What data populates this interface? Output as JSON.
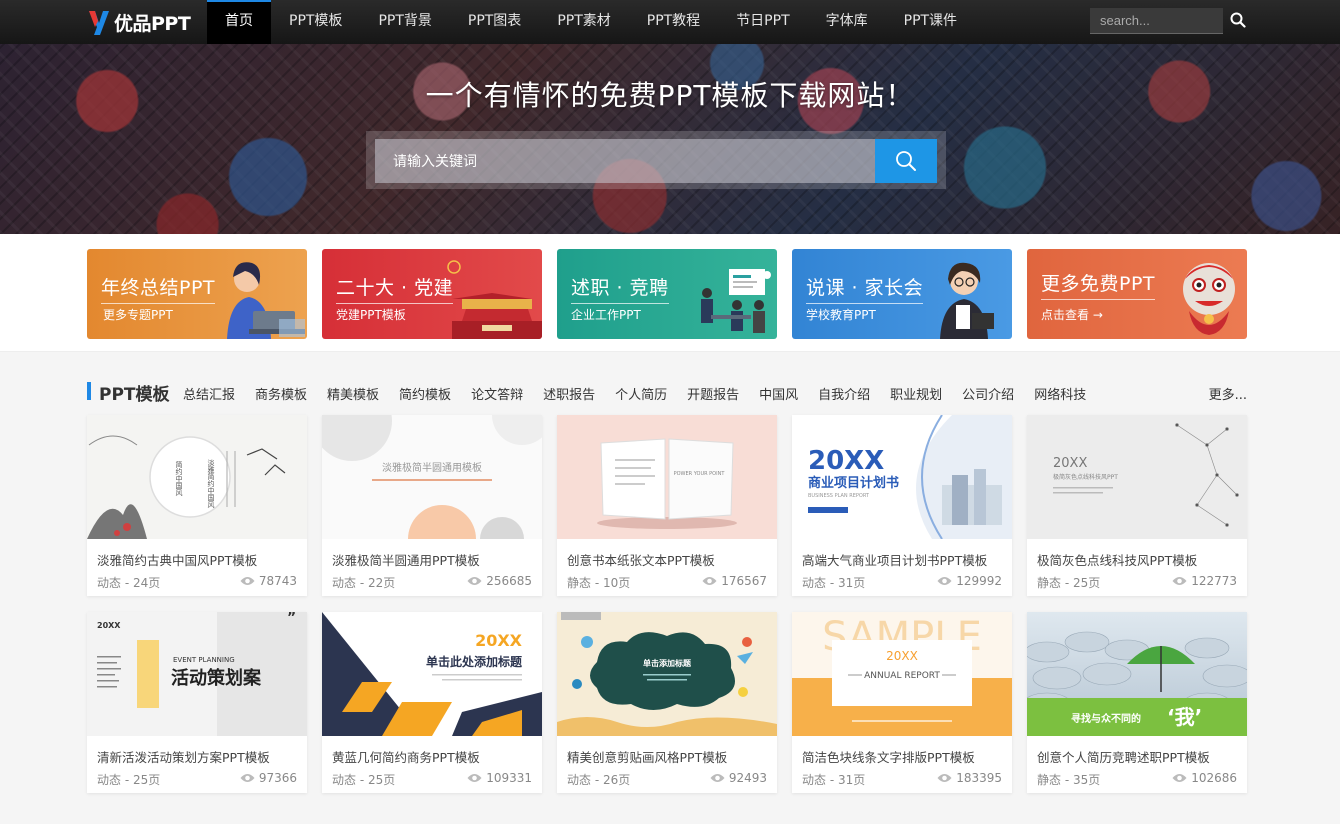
{
  "nav": {
    "logo_text": "优品PPT",
    "items": [
      {
        "label": "首页",
        "active": true
      },
      {
        "label": "PPT模板"
      },
      {
        "label": "PPT背景"
      },
      {
        "label": "PPT图表"
      },
      {
        "label": "PPT素材"
      },
      {
        "label": "PPT教程"
      },
      {
        "label": "节日PPT"
      },
      {
        "label": "字体库"
      },
      {
        "label": "PPT课件"
      }
    ],
    "search_placeholder": "search...",
    "search_icon": "search-icon"
  },
  "banner": {
    "title": "一个有情怀的免费PPT模板下载网站！",
    "search_placeholder": "请输入关键词",
    "search_icon": "search-icon"
  },
  "promos": [
    {
      "title": "年终总结PPT",
      "sub": "更多专题PPT",
      "color": "#e8923a"
    },
    {
      "title": "二十大 · 党建",
      "sub": "党建PPT模板",
      "color": "#d8343c"
    },
    {
      "title": "述职 · 竞聘",
      "sub": "企业工作PPT",
      "color": "#23a794"
    },
    {
      "title": "说课 · 家长会",
      "sub": "学校教育PPT",
      "color": "#3a8fd8"
    },
    {
      "title": "更多免费PPT",
      "sub": "点击查看 →",
      "color": "#e86a44"
    }
  ],
  "section": {
    "title": "PPT模板",
    "categories": [
      "总结汇报",
      "商务模板",
      "精美模板",
      "简约模板",
      "论文答辩",
      "述职报告",
      "个人简历",
      "开题报告",
      "中国风",
      "自我介绍",
      "职业规划",
      "公司介绍",
      "网络科技"
    ],
    "more": "更多..."
  },
  "cards": [
    {
      "title": "淡雅简约古典中国风PPT模板",
      "meta": "动态 - 24页",
      "views": "78743"
    },
    {
      "title": "淡雅极简半圆通用PPT模板",
      "meta": "动态 - 22页",
      "views": "256685"
    },
    {
      "title": "创意书本纸张文本PPT模板",
      "meta": "静态 - 10页",
      "views": "176567"
    },
    {
      "title": "高端大气商业项目计划书PPT模板",
      "meta": "动态 - 31页",
      "views": "129992"
    },
    {
      "title": "极简灰色点线科技风PPT模板",
      "meta": "静态 - 25页",
      "views": "122773"
    },
    {
      "title": "清新活泼活动策划方案PPT模板",
      "meta": "动态 - 25页",
      "views": "97366"
    },
    {
      "title": "黄蓝几何简约商务PPT模板",
      "meta": "动态 - 25页",
      "views": "109331"
    },
    {
      "title": "精美创意剪贴画风格PPT模板",
      "meta": "动态 - 26页",
      "views": "92493"
    },
    {
      "title": "简洁色块线条文字排版PPT模板",
      "meta": "动态 - 31页",
      "views": "183395"
    },
    {
      "title": "创意个人简历竞聘述职PPT模板",
      "meta": "静态 - 35页",
      "views": "102686"
    }
  ],
  "thumbs": {
    "t1": {
      "line1": "淡雅简约中国风",
      "line2": "简约中国风"
    },
    "t2": {
      "title": "淡雅极简半圆通用模板"
    },
    "t3": {
      "book": "POWER YOUR POINT"
    },
    "t4": {
      "big": "20XX",
      "title": "商业项目计划书",
      "sub": "BUSINESS PLAN REPORT"
    },
    "t5": {
      "big": "20XX",
      "title": "极简灰色点线科技风PPT"
    },
    "t6": {
      "year": "20XX",
      "en": "EVENT PLANNING",
      "title": "活动策划案"
    },
    "t7": {
      "year": "20XX",
      "title": "单击此处添加标题"
    },
    "t8": {
      "title": "单击添加标题"
    },
    "t9": {
      "bg": "SAMPLE",
      "year": "20XX",
      "title": "ANNUAL REPORT"
    },
    "t10": {
      "text": "寻找与众不同的",
      "big": "‘我’"
    }
  }
}
